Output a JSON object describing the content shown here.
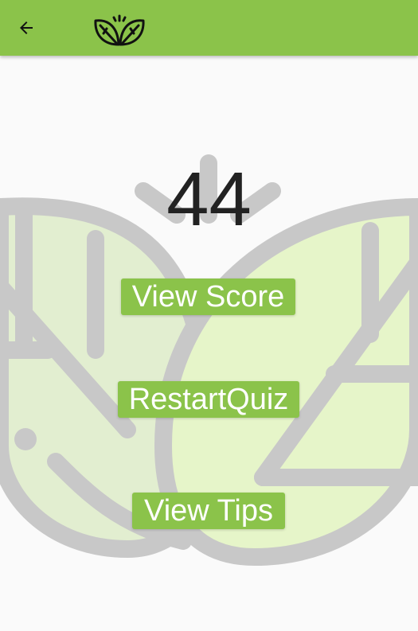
{
  "appbar": {
    "back_icon": "arrow-back-icon",
    "logo_icon": "leaves-logo-icon"
  },
  "score": {
    "value": "44"
  },
  "buttons": {
    "view_score": "View Score",
    "restart_quiz": "RestartQuiz",
    "view_tips": "View Tips"
  },
  "colors": {
    "accent": "#8bc34a",
    "background": "#fafafa",
    "leaf_fill_left": "#e2eed0",
    "leaf_fill_right": "#e6f5c9",
    "leaf_stroke": "#c8c8c8",
    "text": "#222222"
  }
}
